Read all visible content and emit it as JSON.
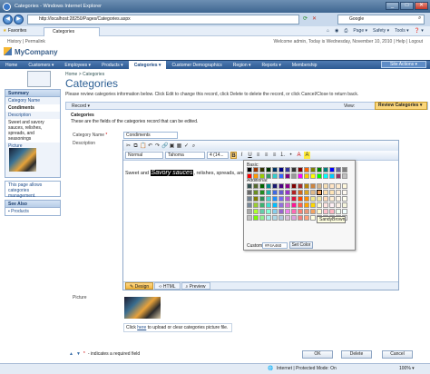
{
  "window": {
    "title": "Categories - Windows Internet Explorer",
    "url": "http://localhost:28250/Pages/Categories.aspx",
    "search_placeholder": "Google",
    "btn_min": "_",
    "btn_max": "□",
    "btn_close": "✕"
  },
  "favbar": {
    "favorites": "Favorites",
    "tab": "Categories",
    "page": "Page ▾",
    "safety": "Safety ▾",
    "tools": "Tools ▾",
    "help": "❓ ▾"
  },
  "app": {
    "history": "History | Permalink",
    "welcome": "Welcome admin, Today is Wednesday, November 10, 2010 | Help | Logout",
    "name": "MyCompany",
    "site_actions": "Site Actions ▾",
    "menu": [
      "Home",
      "Customers ▾",
      "Employees ▾",
      "Products ▾",
      "Categories ▾",
      "Customer Demographics",
      "Region ▾",
      "Reports ▾",
      "Membership"
    ]
  },
  "breadcrumb": "Home > Categories",
  "page_title": "Categories",
  "instruction": "Please review categories information below. Click Edit to change this record, click Delete to delete the record, or click Cancel/Close to return back.",
  "record_menu": "Record ▾",
  "view_label": "View:",
  "view_value": "Review Categories ▾",
  "sidebar": {
    "summary": "Summary",
    "items": [
      "Category Name",
      "Condiments",
      "Description",
      "Sweet and savory sauces, relishes, spreads, and seasonings",
      "Picture"
    ],
    "note": "This page allows categories management.",
    "see_also": "See Also",
    "links": [
      "Products"
    ]
  },
  "form": {
    "section": "Categories",
    "section_desc": "These are the fields of the categories record that can be edited.",
    "category_label": "Category Name",
    "required": "*",
    "category_value": "Condiments",
    "description_label": "Description",
    "picture_label": "Picture",
    "upload_click": "Click",
    "upload_here": "here",
    "upload_rest": "to upload or clear categories picture file.",
    "required_note": "- indicates a required field"
  },
  "editor": {
    "format": "Normal",
    "font": "Tahoma",
    "size": "4 (14...",
    "text_pre": "Sweet and ",
    "text_sel": "Savory sauces",
    "text_post": ", relishes, spreads, and sea",
    "tabs": [
      "Design",
      "HTML",
      "Preview"
    ]
  },
  "picker": {
    "basic": "Basic:",
    "additional": "Additional:",
    "tooltip": "SandyBrown",
    "custom_label": "Custom:",
    "custom_value": "#F4A460",
    "set_color": "Set Color",
    "basic_colors": [
      "#000000",
      "#993300",
      "#333300",
      "#003300",
      "#003366",
      "#000080",
      "#333399",
      "#333333",
      "#800000",
      "#FF6600",
      "#808000",
      "#008000",
      "#008080",
      "#0000FF",
      "#666699",
      "#808080",
      "#FF0000",
      "#FF9900",
      "#99CC00",
      "#339966",
      "#33CCCC",
      "#3366FF",
      "#800080",
      "#999999",
      "#FF00FF",
      "#FFCC00",
      "#FFFF00",
      "#00FF00",
      "#00FFFF",
      "#00CCFF",
      "#993366",
      "#C0C0C0"
    ],
    "additional_colors": [
      "#2F4F4F",
      "#556B2F",
      "#006400",
      "#008B8B",
      "#191970",
      "#4B0082",
      "#8B008B",
      "#800000",
      "#A52A2A",
      "#B8860B",
      "#CD853F",
      "#D2B48C",
      "#F5DEB3",
      "#FFE4C4",
      "#FFEBCD",
      "#FFF8DC",
      "#696969",
      "#6B8E23",
      "#228B22",
      "#20B2AA",
      "#4169E1",
      "#6A5ACD",
      "#9932CC",
      "#B22222",
      "#D2691E",
      "#DAA520",
      "#DEB887",
      "#F4A460",
      "#FFDEAD",
      "#FFE4B5",
      "#FAEBD7",
      "#FFFAF0",
      "#708090",
      "#808000",
      "#2E8B57",
      "#48D1CC",
      "#1E90FF",
      "#7B68EE",
      "#BA55D3",
      "#DC143C",
      "#FF4500",
      "#FF8C00",
      "#F0E68C",
      "#EEE8AA",
      "#FFDAB9",
      "#FFEFD5",
      "#FDF5E6",
      "#FFFFF0",
      "#778899",
      "#9ACD32",
      "#3CB371",
      "#40E0D0",
      "#00BFFF",
      "#9370DB",
      "#DA70D6",
      "#FF1493",
      "#FF6347",
      "#FFA500",
      "#FFD700",
      "#FAFAD2",
      "#FFE4E1",
      "#FFF0F5",
      "#FAF0E6",
      "#F5F5DC",
      "#A9A9A9",
      "#ADFF2F",
      "#66CDAA",
      "#7FFFD4",
      "#87CEEB",
      "#9966CC",
      "#EE82EE",
      "#FF69B4",
      "#FA8072",
      "#E9967A",
      "#F4A460",
      "#FFFACD",
      "#FFC0CB",
      "#FFB6C1",
      "#F0FFF0",
      "#F0FFFF",
      "#C0C0C0",
      "#7CFC00",
      "#90EE90",
      "#AFEEEE",
      "#ADD8E6",
      "#B0C4DE",
      "#D8BFD8",
      "#DDA0DD",
      "#F08080",
      "#FFA07A",
      "#FFFFE0",
      "#E6E6FA",
      "#FFF5EE",
      "#F8F8FF",
      "#F5F5F5",
      "#FFFFFF"
    ]
  },
  "buttons": {
    "ok": "OK",
    "delete": "Delete",
    "cancel": "Cancel"
  },
  "status": {
    "zone": "Internet | Protected Mode: On",
    "zoom": "100% ▾"
  }
}
